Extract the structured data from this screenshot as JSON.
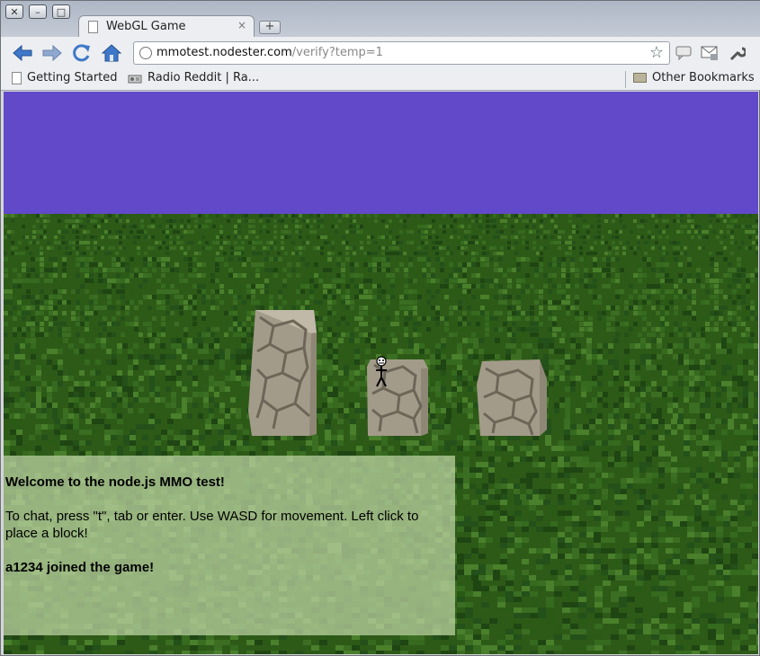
{
  "browser": {
    "tab": {
      "title": "WebGL Game",
      "close": "×"
    },
    "new_tab": "+",
    "window_controls": {
      "close": "✕",
      "minimize": "–",
      "maximize": "□"
    },
    "address": {
      "host": "mmotest.nodester.com",
      "path": "/verify?temp=1"
    },
    "bookmarks": [
      {
        "label": "Getting Started",
        "icon": "page-icon"
      },
      {
        "label": "Radio Reddit | Ra...",
        "icon": "radio-icon"
      }
    ],
    "other_bookmarks": "Other Bookmarks"
  },
  "game": {
    "colors": {
      "sky": "#6249c9",
      "grass": "#2e5a18",
      "stone": "#a39b8a"
    },
    "chat": {
      "welcome": "Welcome to the node.js MMO test!",
      "instructions": "To chat, press \"t\", tab or enter. Use WASD for movement. Left click to place a block!",
      "join": "a1234 joined the game!"
    }
  }
}
